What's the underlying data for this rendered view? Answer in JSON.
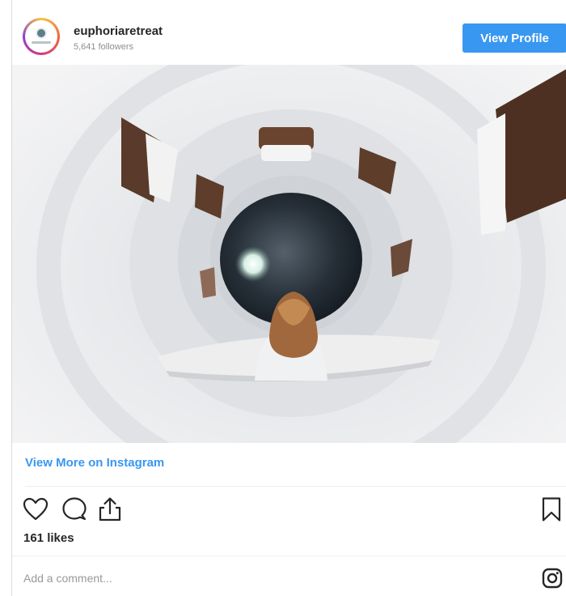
{
  "header": {
    "username": "euphoriaretreat",
    "followers": "5,641 followers",
    "view_profile_label": "View Profile"
  },
  "post": {
    "image_icon": "photo-spiral-staircase"
  },
  "links": {
    "view_more": "View More on Instagram"
  },
  "actions": {
    "like_icon": "heart-icon",
    "comment_icon": "comment-icon",
    "share_icon": "share-icon",
    "save_icon": "bookmark-icon"
  },
  "likes": "161 likes",
  "comment": {
    "placeholder": "Add a comment..."
  },
  "colors": {
    "accent": "#3897f0",
    "text": "#262626",
    "muted": "#8e8e8e"
  }
}
